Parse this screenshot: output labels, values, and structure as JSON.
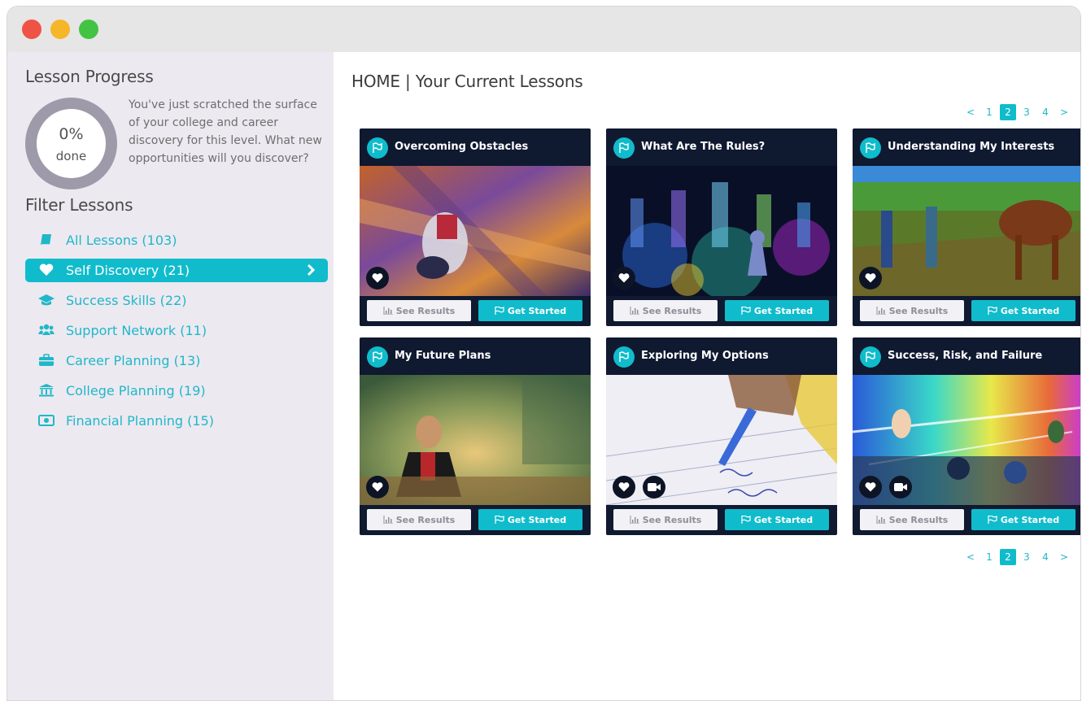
{
  "sidebar": {
    "progress_heading": "Lesson Progress",
    "progress_percent": "0%",
    "progress_done_label": "done",
    "progress_value": 0,
    "progress_message": "You've just scratched the surface of your college and career discovery for this level. What new opportunities will you discover?",
    "filter_heading": "Filter Lessons",
    "filters": [
      {
        "label": "All Lessons (103)",
        "icon": "book-icon",
        "active": false
      },
      {
        "label": "Self Discovery (21)",
        "icon": "heart-icon",
        "active": true
      },
      {
        "label": "Success Skills (22)",
        "icon": "graduation-cap-icon",
        "active": false
      },
      {
        "label": "Support Network (11)",
        "icon": "users-icon",
        "active": false
      },
      {
        "label": "Career Planning (13)",
        "icon": "briefcase-icon",
        "active": false
      },
      {
        "label": "College Planning (19)",
        "icon": "university-icon",
        "active": false
      },
      {
        "label": "Financial Planning (15)",
        "icon": "money-icon",
        "active": false
      }
    ]
  },
  "main": {
    "title": "HOME | Your Current Lessons",
    "pager": {
      "prev": "<",
      "pages": [
        "1",
        "2",
        "3",
        "4"
      ],
      "current": "2",
      "next": ">"
    },
    "see_results_label": "See Results",
    "get_started_label": "Get Started",
    "cards": [
      {
        "title": "Overcoming Obstacles",
        "video": false
      },
      {
        "title": "What Are The Rules?",
        "video": false
      },
      {
        "title": "Understanding My Interests",
        "video": false
      },
      {
        "title": "My Future Plans",
        "video": false
      },
      {
        "title": "Exploring My Options",
        "video": true
      },
      {
        "title": "Success, Risk, and Failure",
        "video": true
      }
    ]
  },
  "colors": {
    "accent": "#10bccc",
    "card_bg": "#0f1930",
    "sidebar_bg": "#ede9f1"
  }
}
